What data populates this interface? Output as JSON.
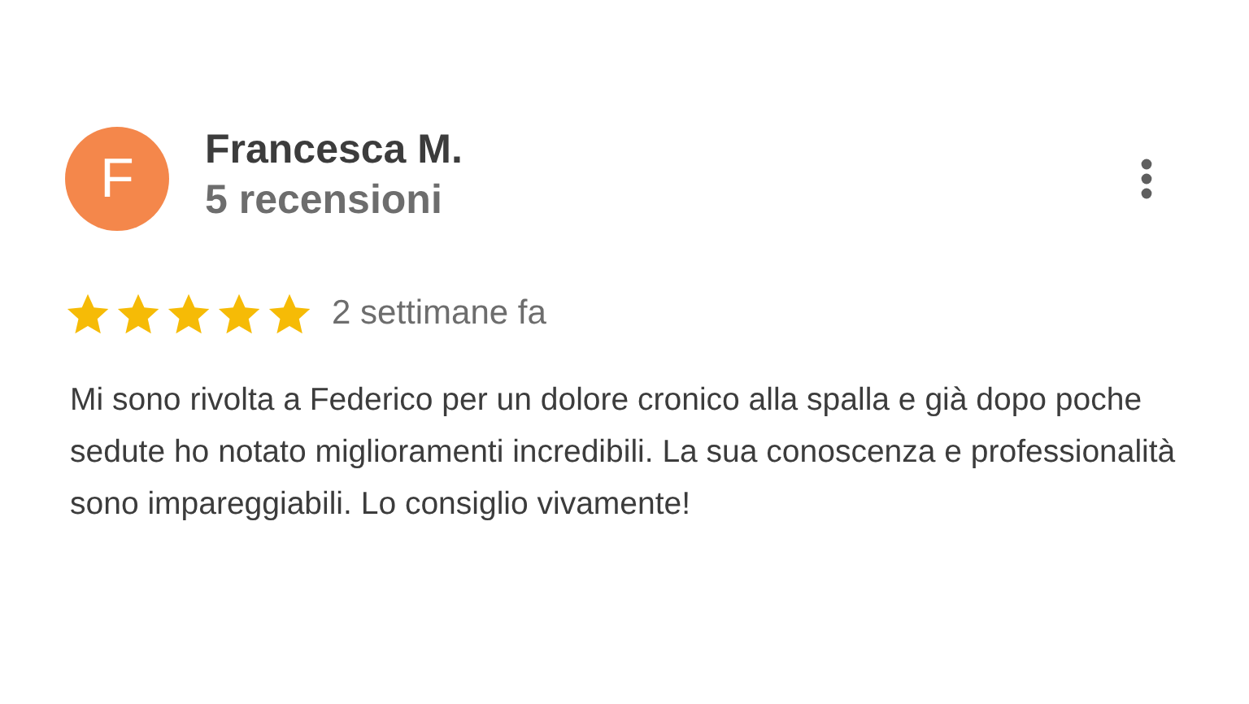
{
  "review": {
    "avatar_letter": "F",
    "author": "Francesca M.",
    "review_count": "5 recensioni",
    "stars": 5,
    "time": "2 settimane fa",
    "text": "Mi sono rivolta a Federico per un dolore cronico alla spalla e già dopo poche sedute ho notato miglioramenti incredibili. La sua conoscenza e professionalità sono impareggiabili. Lo consiglio vivamente!"
  }
}
